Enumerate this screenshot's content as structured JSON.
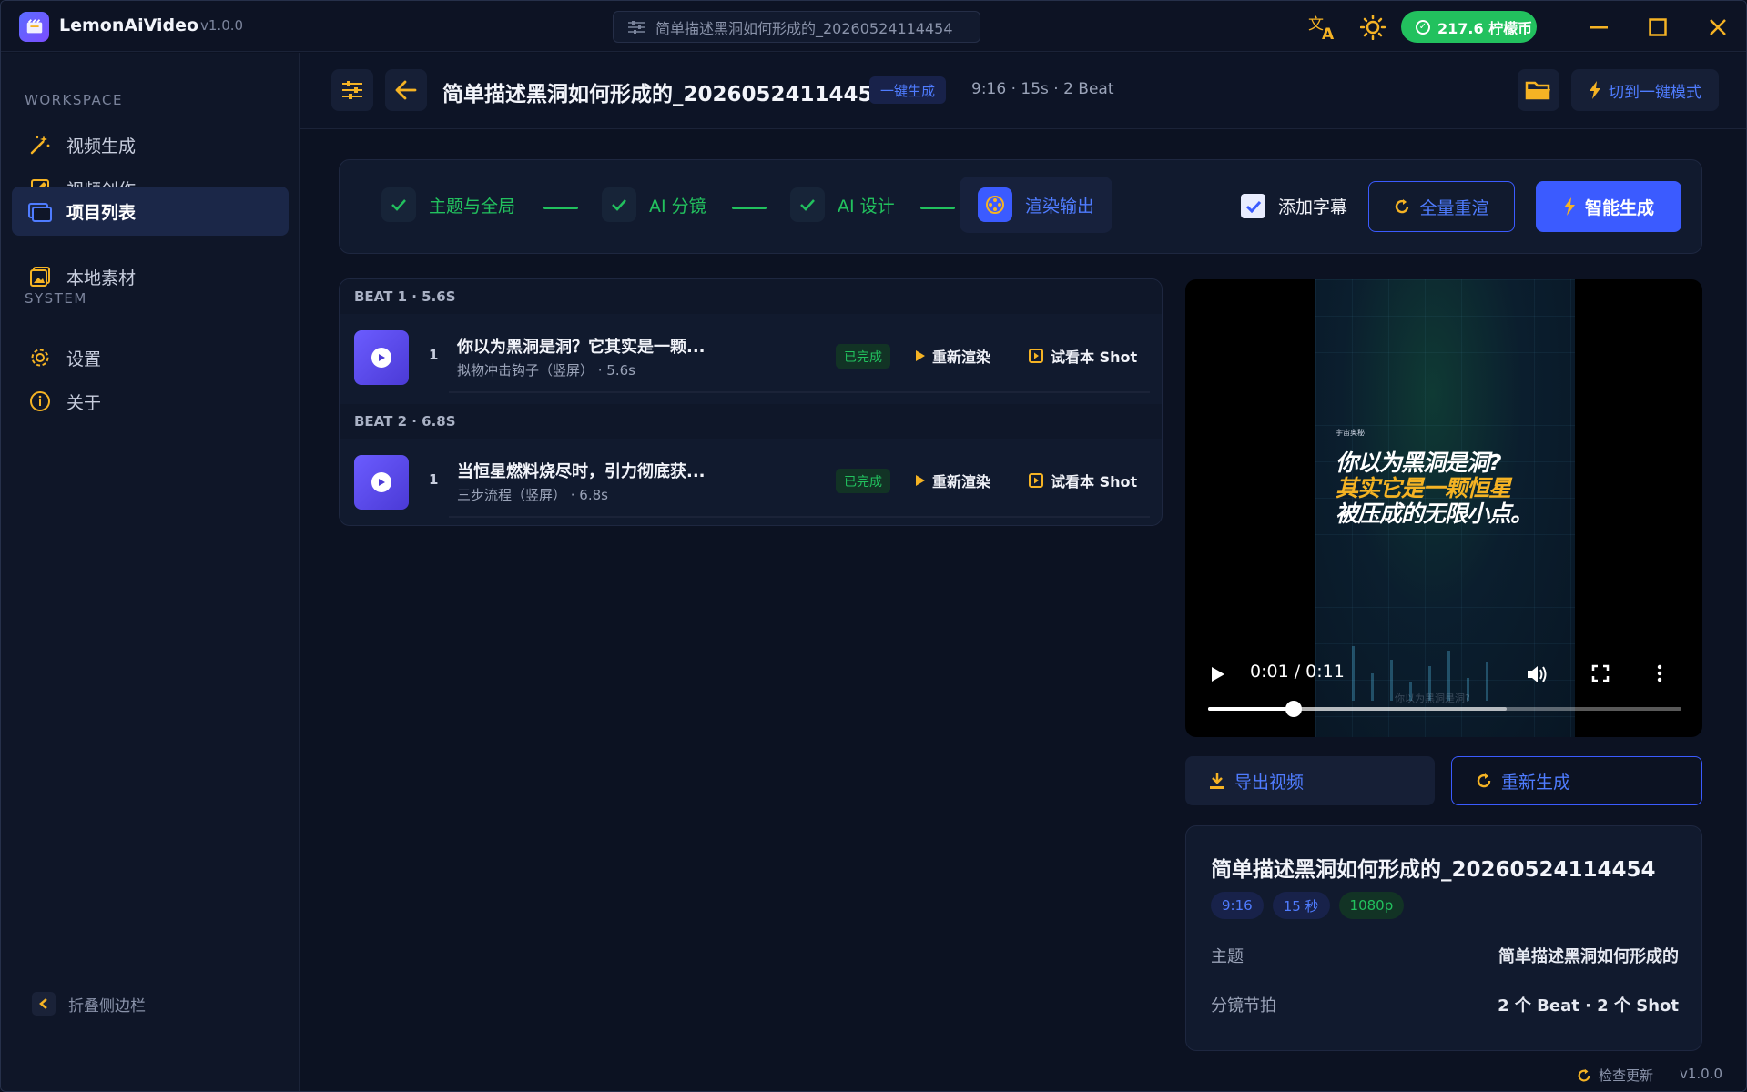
{
  "app": {
    "name": "LemonAiVideo",
    "version": "v1.0.0"
  },
  "titlebar": {
    "window_title": "简单描述黑洞如何形成的_20260524114454",
    "coin": "217.6 柠檬币",
    "icons": [
      "translate-icon",
      "theme-icon"
    ]
  },
  "sidebar": {
    "workspace_label": "WORKSPACE",
    "system_label": "SYSTEM",
    "items": [
      {
        "label": "视频生成",
        "icon": "magic-wand-icon"
      },
      {
        "label": "视频创作",
        "icon": "edit-icon"
      },
      {
        "label": "项目列表",
        "icon": "folders-icon"
      },
      {
        "label": "本地素材",
        "icon": "image-icon"
      },
      {
        "label": "设置",
        "icon": "gear-icon"
      },
      {
        "label": "关于",
        "icon": "info-icon"
      }
    ],
    "collapse": "折叠侧边栏"
  },
  "header": {
    "title": "简单描述黑洞如何形成的_20260524114454",
    "mode_badge": "一键生成",
    "meta": "9:16 · 15s · 2 Beat",
    "switch_label": "切到一键模式"
  },
  "steps": {
    "items": [
      {
        "label": "主题与全局"
      },
      {
        "label": "AI 分镜"
      },
      {
        "label": "AI 设计"
      },
      {
        "label": "渲染输出"
      }
    ],
    "subtitles_label": "添加字幕",
    "rerender_all": "全量重渲",
    "smart_generate": "智能生成"
  },
  "beats": [
    {
      "header": "BEAT 1 · 5.6S",
      "shots": [
        {
          "num": "1",
          "text": "你以为黑洞是洞？它其实是一颗...",
          "sub": "拟物冲击钩子（竖屏） · 5.6s",
          "status": "已完成",
          "rerender": "重新渲染",
          "preview": "试看本 Shot"
        }
      ]
    },
    {
      "header": "BEAT 2 · 6.8S",
      "shots": [
        {
          "num": "1",
          "text": "当恒星燃料烧尽时，引力彻底获...",
          "sub": "三步流程（竖屏） · 6.8s",
          "status": "已完成",
          "rerender": "重新渲染",
          "preview": "试看本 Shot"
        }
      ]
    }
  ],
  "player": {
    "time": "0:01 / 0:11",
    "progress": 0.18,
    "buffered": 0.63,
    "caption_line1": "你以为黑洞是洞?",
    "caption_line2": "其实它是一颗恒星",
    "caption_line3": "被压成的无限小点。",
    "tiny_text": "宇宙奥秘",
    "ghost_subtitle": "你以为黑洞是洞?"
  },
  "actions": {
    "export": "导出视频",
    "regenerate": "重新生成"
  },
  "info": {
    "title": "简单描述黑洞如何形成的_20260524114454",
    "tags": [
      "9:16",
      "15 秒",
      "1080p"
    ],
    "rows": [
      {
        "key": "主题",
        "value": "简单描述黑洞如何形成的"
      },
      {
        "key": "分镜节拍",
        "value": "2 个 Beat · 2 个 Shot"
      }
    ]
  },
  "status": {
    "check_update": "检查更新",
    "version": "v1.0.0"
  },
  "colors": {
    "accent": "#3b5bff",
    "success": "#22c15e",
    "coin": "#22c15e",
    "caption_highlight": "#f5b324"
  }
}
